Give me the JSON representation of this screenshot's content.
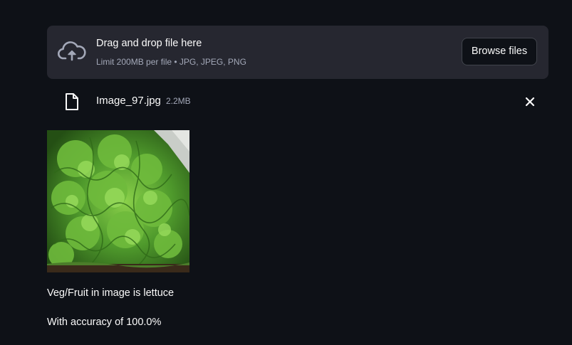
{
  "uploader": {
    "title": "Drag and drop file here",
    "subtitle": "Limit 200MB per file • JPG, JPEG, PNG",
    "browse_label": "Browse files",
    "icon": "cloud-upload-icon"
  },
  "file": {
    "name": "Image_97.jpg",
    "size": "2.2MB",
    "icon": "file-icon",
    "remove_icon": "close-icon"
  },
  "image": {
    "subject": "lettuce"
  },
  "results": {
    "prediction": "Veg/Fruit in image is lettuce",
    "accuracy": "With accuracy of 100.0%"
  },
  "colors": {
    "background": "#0e1117",
    "panel": "#262730",
    "text": "#fafafa",
    "muted_text": "#a3a8b8"
  }
}
